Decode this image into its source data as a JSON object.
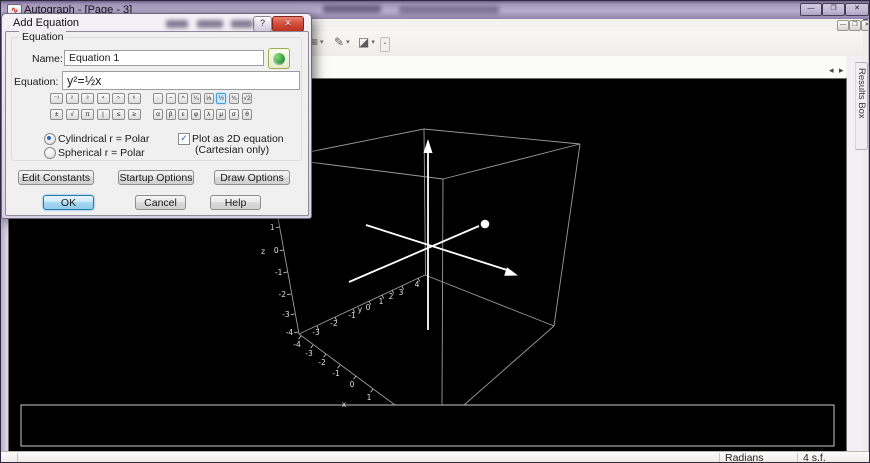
{
  "window": {
    "title": "Autograph - [Page - 3]",
    "controls": {
      "minimize": "—",
      "maximize": "❐",
      "close": "✕"
    },
    "mdi": {
      "minimize": "—",
      "restore": "❐",
      "close": "✕"
    }
  },
  "toolbar": {
    "icons": [
      {
        "name": "line-style-icon",
        "glyph": "≡"
      },
      {
        "name": "pencil-icon",
        "glyph": "✎"
      },
      {
        "name": "eraser-icon",
        "glyph": "◪"
      }
    ],
    "caret": "▾",
    "overflow_glyph": "⌄"
  },
  "page_nav": {
    "prev": "◂",
    "next": "▸",
    "close": "✕"
  },
  "results_tab": "Results Box",
  "dialog": {
    "title": "Add Equation",
    "help_button": "?",
    "close_button": "✕",
    "group_label": "Equation",
    "name_label": "Name:",
    "name_value": "Equation 1",
    "equation_label": "Equation:",
    "equation_value": "y²=½x",
    "symbol_rows": [
      [
        [
          "⁻¹",
          "²",
          "³",
          "⁴",
          "⁵",
          "⁶"
        ],
        [
          "·",
          "−",
          "^"
        ],
        [
          "¼",
          "⅓",
          "½",
          "¾"
        ],
        [
          "√2"
        ]
      ],
      [
        [
          "±",
          "√",
          "π",
          "|",
          "≤",
          "≥"
        ],
        [
          "α",
          "β",
          "ε"
        ],
        [
          "φ",
          "λ",
          "μ",
          "σ"
        ],
        [
          "θ"
        ]
      ]
    ],
    "active_symbol": "½",
    "radios": [
      {
        "label": "Cylindrical  r =  Polar",
        "selected": true
      },
      {
        "label": "Spherical  r =  Polar",
        "selected": false
      }
    ],
    "checkbox": {
      "label": "Plot as 2D equation",
      "sub": "(Cartesian only)",
      "checked": true
    },
    "buttons": {
      "edit_constants": "Edit Constants",
      "startup_options": "Startup Options",
      "draw_options": "Draw Options",
      "ok": "OK",
      "cancel": "Cancel",
      "help": "Help"
    }
  },
  "scene": {
    "bg": "#000000",
    "axis_color": "#ffffff",
    "cube_color": "#9b9b9b",
    "x_label": "x",
    "x_ticks": [
      "-4",
      "-3",
      "-2",
      "-1",
      "0",
      "1"
    ],
    "y_label": "y",
    "y_ticks": [
      "-3",
      "-2",
      "-1",
      "0",
      "1",
      "2",
      "3",
      "4"
    ],
    "z_label": "z",
    "z_ticks": [
      "1",
      "0",
      "-1",
      "-2",
      "-3",
      "-4"
    ]
  },
  "statusbar": {
    "angle_mode": "Radians",
    "precision": "4 s.f."
  }
}
